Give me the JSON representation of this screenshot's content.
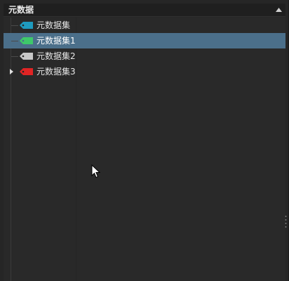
{
  "panel": {
    "title": "元数据"
  },
  "tree": {
    "items": [
      {
        "label": "元数据集",
        "tag_color": "#1e9bbf",
        "selected": false,
        "expandable": false
      },
      {
        "label": "元数据集1",
        "tag_color": "#3ec86a",
        "selected": true,
        "expandable": false
      },
      {
        "label": "元数据集2",
        "tag_color": "#c8c8c8",
        "selected": false,
        "expandable": false
      },
      {
        "label": "元数据集3",
        "tag_color": "#e02424",
        "selected": false,
        "expandable": true
      }
    ]
  },
  "colors": {
    "selection": "#4b6f8a",
    "panel_bg": "#292929",
    "header_bg": "#1f1f1f",
    "text": "#e6e6e6"
  },
  "icons": {
    "collapse": "chevron-up-icon",
    "tag": "tag-icon",
    "expander": "triangle-right-icon",
    "cursor": "mouse-pointer-icon"
  }
}
